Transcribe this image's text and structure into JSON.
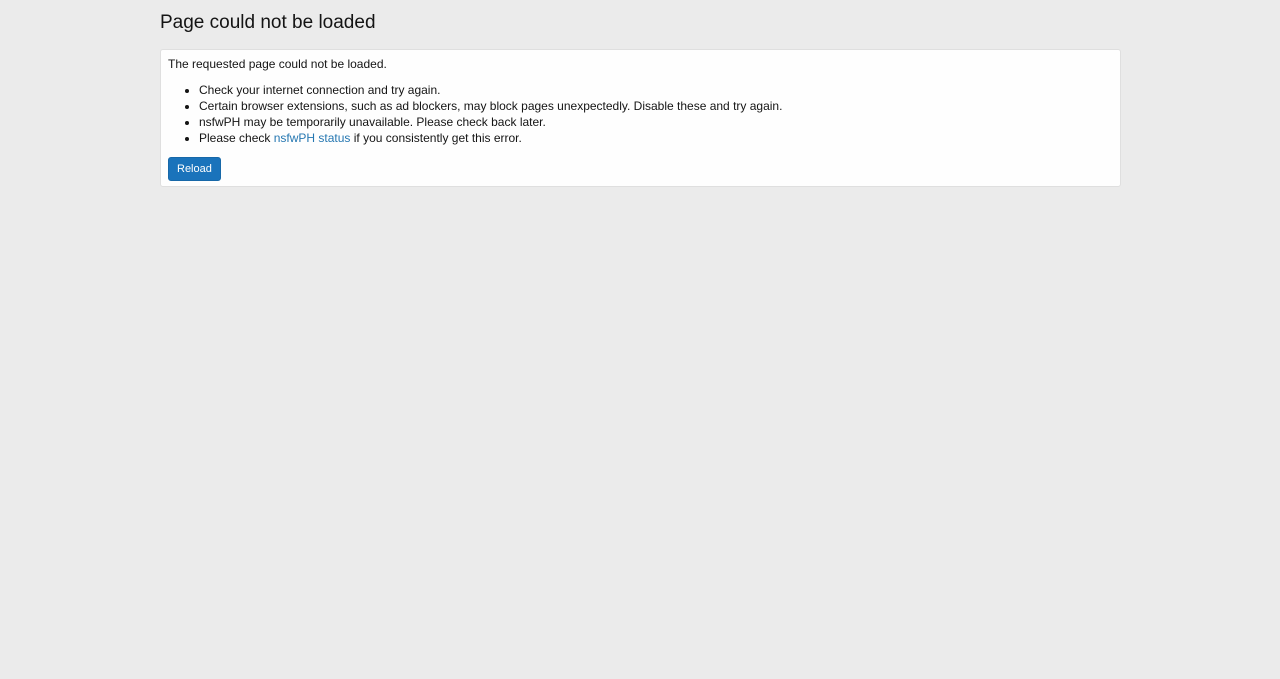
{
  "page": {
    "title": "Page could not be loaded"
  },
  "error_block": {
    "intro": "The requested page could not be loaded.",
    "tips": [
      "Check your internet connection and try again.",
      "Certain browser extensions, such as ad blockers, may block pages unexpectedly. Disable these and try again.",
      "nsfwPH may be temporarily unavailable. Please check back later."
    ],
    "status_tip": {
      "prefix": "Please check ",
      "link_label": "nsfwPH status",
      "suffix": " if you consistently get this error."
    },
    "reload_label": "Reload"
  },
  "colors": {
    "background": "#ebebeb",
    "panel": "#fefefe",
    "link": "#2577b1",
    "button": "#1a73bb"
  }
}
